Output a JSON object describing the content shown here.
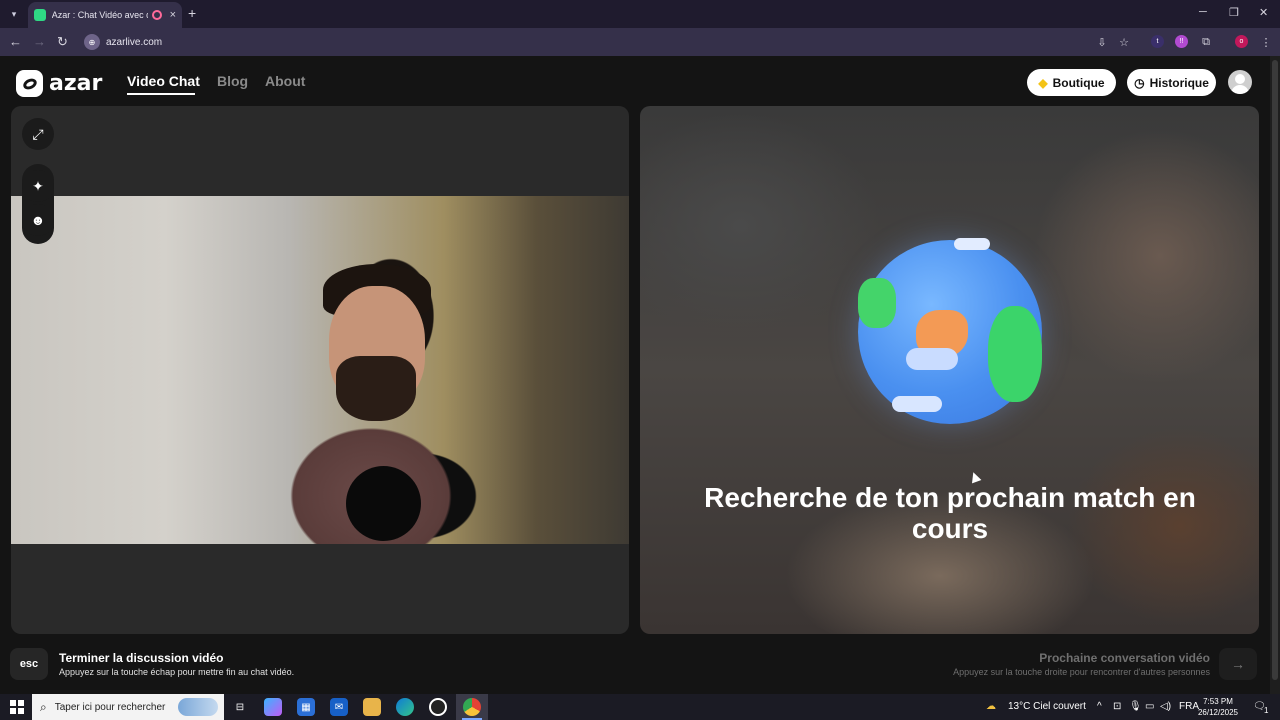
{
  "browser": {
    "tab_title": "Azar : Chat Vidéo avec de n",
    "tab_close": "×",
    "new_tab": "+",
    "url": "azarlive.com",
    "extensions": [
      "t",
      "!!",
      "o"
    ]
  },
  "site": {
    "logo_text": "azar",
    "nav": [
      {
        "label": "Video Chat",
        "active": true
      },
      {
        "label": "Blog",
        "active": false
      },
      {
        "label": "About",
        "active": false
      }
    ],
    "boutique_label": "Boutique",
    "historique_label": "Historique"
  },
  "main": {
    "search_status": "Recherche de ton prochain match en cours"
  },
  "footer": {
    "esc_key": "esc",
    "end_title": "Terminer la discussion vidéo",
    "end_sub": "Appuyez sur la touche échap pour mettre fin au chat vidéo.",
    "next_title": "Prochaine conversation vidéo",
    "next_sub": "Appuyez sur la touche droite pour rencontrer d'autres personnes",
    "next_arrow": "→"
  },
  "taskbar": {
    "search_placeholder": "Taper ici pour rechercher",
    "weather": "13°C  Ciel couvert",
    "language": "FRA",
    "time": "7:53 PM",
    "date": "26/12/2025",
    "notifications": "1"
  },
  "colors": {
    "accent_green": "#2fd985",
    "page_bg": "#141414",
    "chrome_bg": "#1f1b2e"
  }
}
